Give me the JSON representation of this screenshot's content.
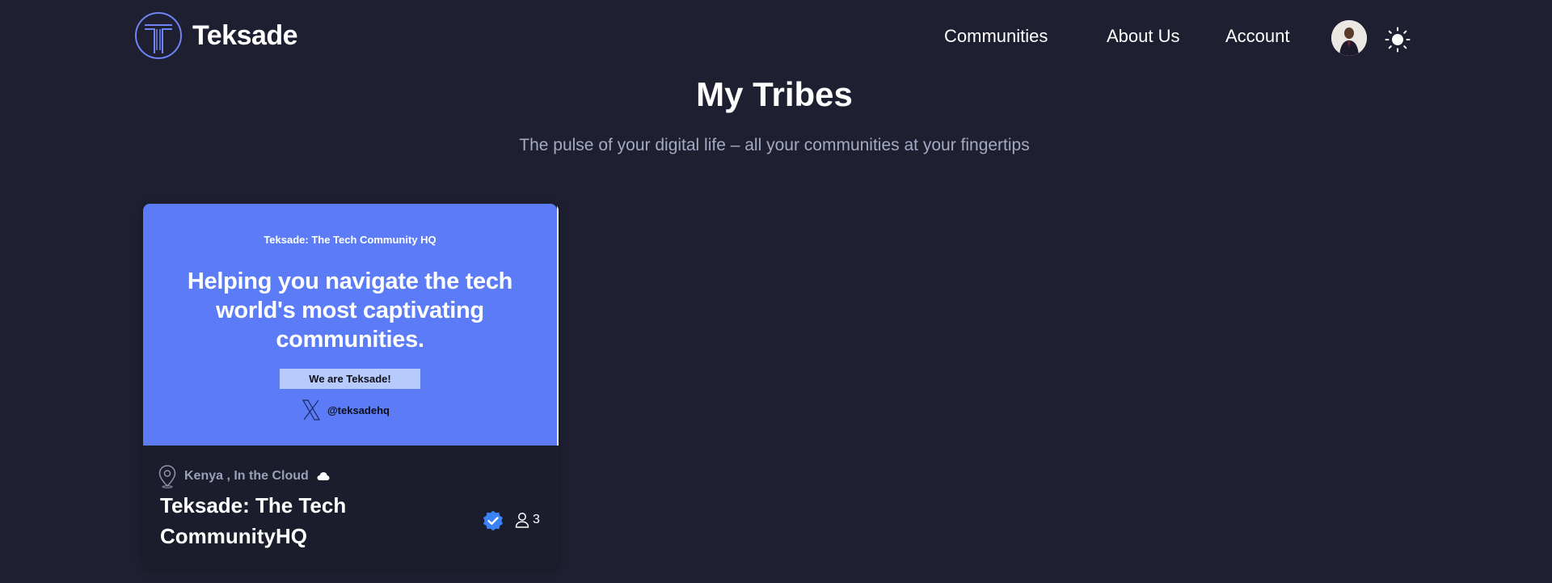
{
  "brand": {
    "name": "Teksade",
    "logo_icon": "teksade-logo-icon",
    "accent": "#5b7cf6"
  },
  "nav": {
    "links": [
      "Communities",
      "About Us",
      "Account"
    ],
    "avatar_icon": "user-avatar",
    "theme_toggle_icon": "sun-icon"
  },
  "hero": {
    "title": "My Tribes",
    "subtitle": "The pulse of your digital life – all your communities at your fingertips"
  },
  "communities": [
    {
      "banner": {
        "eyebrow": "Teksade: The Tech Community HQ",
        "headline": "Helping you navigate the tech world's most captivating communities.",
        "cta": "We are Teksade!",
        "handle": "@teksadehq",
        "background": "#5b7cf6"
      },
      "location": "Kenya , In the Cloud",
      "name": "Teksade: The Tech CommunityHQ",
      "verified": true,
      "members": "3"
    }
  ]
}
